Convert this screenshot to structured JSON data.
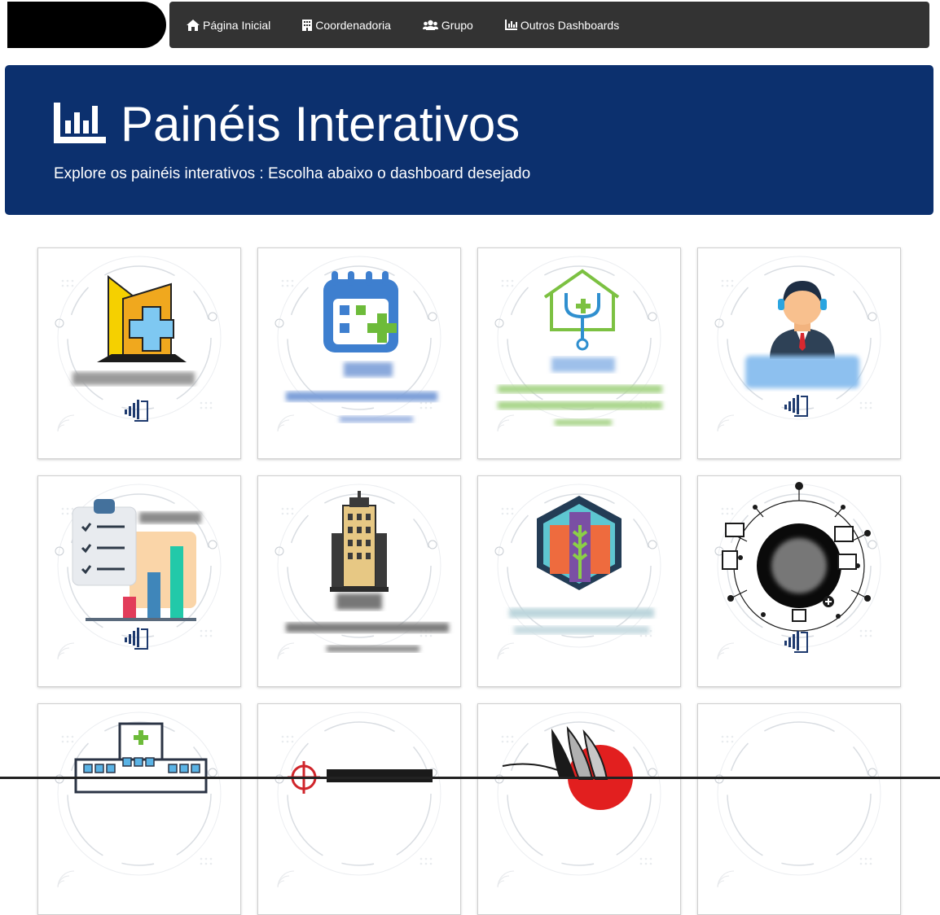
{
  "nav": {
    "items": [
      {
        "label": "Página Inicial",
        "icon": "home-icon"
      },
      {
        "label": "Coordenadoria",
        "icon": "building-icon"
      },
      {
        "label": "Grupo",
        "icon": "users-icon"
      },
      {
        "label": "Outros Dashboards",
        "icon": "bar-chart-icon"
      }
    ]
  },
  "hero": {
    "title": "Painéis Interativos",
    "subtitle": "Explore os painéis interativos : Escolha abaixo o dashboard desejado",
    "icon": "bar-chart-icon",
    "background": "#0c306e"
  },
  "cards": [
    {
      "icon": "hospital-building-icon"
    },
    {
      "icon": "calendar-plus-icon"
    },
    {
      "icon": "home-health-stethoscope-icon"
    },
    {
      "icon": "call-center-agent-icon"
    },
    {
      "icon": "checklist-chart-icon"
    },
    {
      "icon": "office-tower-icon"
    },
    {
      "icon": "hexagon-buildings-icon"
    },
    {
      "icon": "network-brain-icon"
    },
    {
      "icon": "hospital-icon"
    },
    {
      "icon": "target-logo-icon"
    },
    {
      "icon": "wings-logo-icon"
    },
    {
      "icon": "blank-card-icon"
    }
  ],
  "colors": {
    "navbar": "#333333",
    "accent": "#0c306e"
  }
}
